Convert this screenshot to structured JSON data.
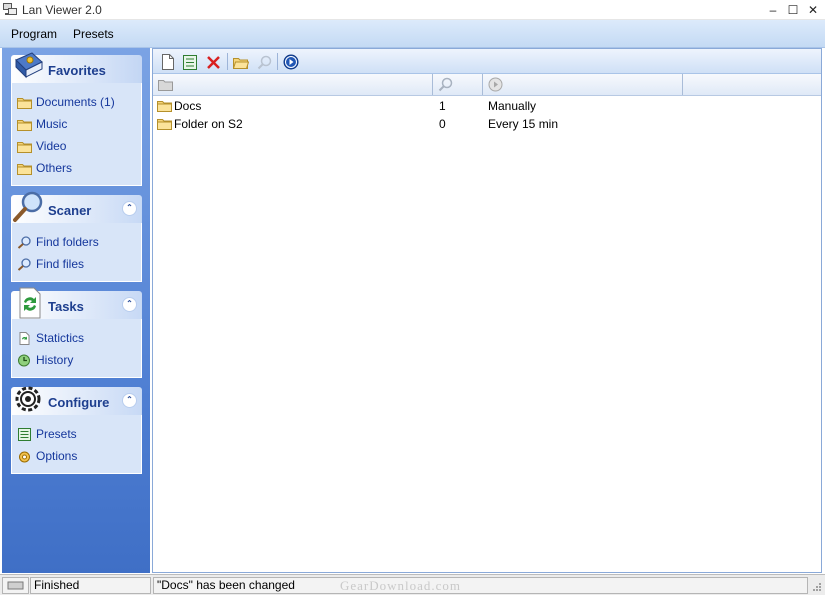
{
  "window": {
    "title": "Lan Viewer 2.0",
    "controls": {
      "minimize": "–",
      "maximize": "☐",
      "close": "✕"
    }
  },
  "menubar": {
    "items": [
      "Program",
      "Presets"
    ]
  },
  "sidebar": {
    "groups": [
      {
        "title": "Favorites",
        "icon": "book-icon",
        "collapsible": false,
        "items": [
          {
            "label": "Documents (1)",
            "icon": "folder-icon"
          },
          {
            "label": "Music",
            "icon": "folder-icon"
          },
          {
            "label": "Video",
            "icon": "folder-icon"
          },
          {
            "label": "Others",
            "icon": "folder-icon"
          }
        ]
      },
      {
        "title": "Scaner",
        "icon": "magnifier-icon",
        "collapsible": true,
        "collapse_glyph": "⌃",
        "items": [
          {
            "label": "Find folders",
            "icon": "magnifier-icon"
          },
          {
            "label": "Find files",
            "icon": "magnifier-icon"
          }
        ]
      },
      {
        "title": "Tasks",
        "icon": "refresh-page-icon",
        "collapsible": true,
        "collapse_glyph": "⌃",
        "items": [
          {
            "label": "Statictics",
            "icon": "refresh-page-icon"
          },
          {
            "label": "History",
            "icon": "history-icon"
          }
        ]
      },
      {
        "title": "Configure",
        "icon": "gear-icon",
        "collapsible": true,
        "collapse_glyph": "⌃",
        "items": [
          {
            "label": "Presets",
            "icon": "list-icon"
          },
          {
            "label": "Options",
            "icon": "options-icon"
          }
        ]
      }
    ]
  },
  "toolbar": {
    "buttons": [
      "new-document-icon",
      "list-icon",
      "delete-icon",
      "open-folder-icon",
      "search-icon",
      "play-icon"
    ]
  },
  "table": {
    "columns": [
      {
        "icon": "folder-icon"
      },
      {
        "icon": "search-icon"
      },
      {
        "icon": "play-icon"
      },
      {
        "icon": ""
      }
    ],
    "rows": [
      {
        "name": "Docs",
        "count": "1",
        "schedule": "Manually"
      },
      {
        "name": "Folder on S2",
        "count": "0",
        "schedule": "Every 15 min"
      }
    ]
  },
  "statusbar": {
    "state": "Finished",
    "message": "\"Docs\" has been changed",
    "watermark": "GearDownload.com"
  },
  "colors": {
    "accent": "#1e3f8f",
    "link": "#15379c",
    "sidebar_top": "#7ba3e4",
    "sidebar_bottom": "#3f6fc6"
  }
}
